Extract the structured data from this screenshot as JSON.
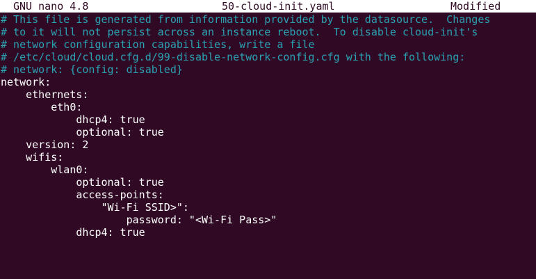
{
  "title_bar": {
    "app": "GNU nano 4.8",
    "filename": "50-cloud-init.yaml",
    "status": "Modified"
  },
  "colors": {
    "background": "#300a24",
    "comment": "#2aa1b3",
    "text": "#ffffff",
    "title_bar_bg": "#ffffff"
  },
  "lines": [
    {
      "text": "# This file is generated from information provided by the datasource.  Changes",
      "type": "comment"
    },
    {
      "text": "# to it will not persist across an instance reboot.  To disable cloud-init's",
      "type": "comment"
    },
    {
      "text": "# network configuration capabilities, write a file",
      "type": "comment"
    },
    {
      "text": "# /etc/cloud/cloud.cfg.d/99-disable-network-config.cfg with the following:",
      "type": "comment"
    },
    {
      "text": "# network: {config: disabled}",
      "type": "comment"
    },
    {
      "text": "network:",
      "type": "code"
    },
    {
      "text": "    ethernets:",
      "type": "code"
    },
    {
      "text": "        eth0:",
      "type": "code"
    },
    {
      "text": "            dhcp4: true",
      "type": "code"
    },
    {
      "text": "            optional: true",
      "type": "code"
    },
    {
      "text": "    version: 2",
      "type": "code"
    },
    {
      "text": "    wifis:",
      "type": "code"
    },
    {
      "text": "        wlan0:",
      "type": "code"
    },
    {
      "text": "            optional: true",
      "type": "code"
    },
    {
      "text": "            access-points:",
      "type": "code"
    },
    {
      "text": "                \"Wi-Fi SSID>\":",
      "type": "code"
    },
    {
      "text": "                    password: \"<Wi-Fi Pass>\"",
      "type": "code"
    },
    {
      "text": "            dhcp4: true",
      "type": "code"
    }
  ]
}
